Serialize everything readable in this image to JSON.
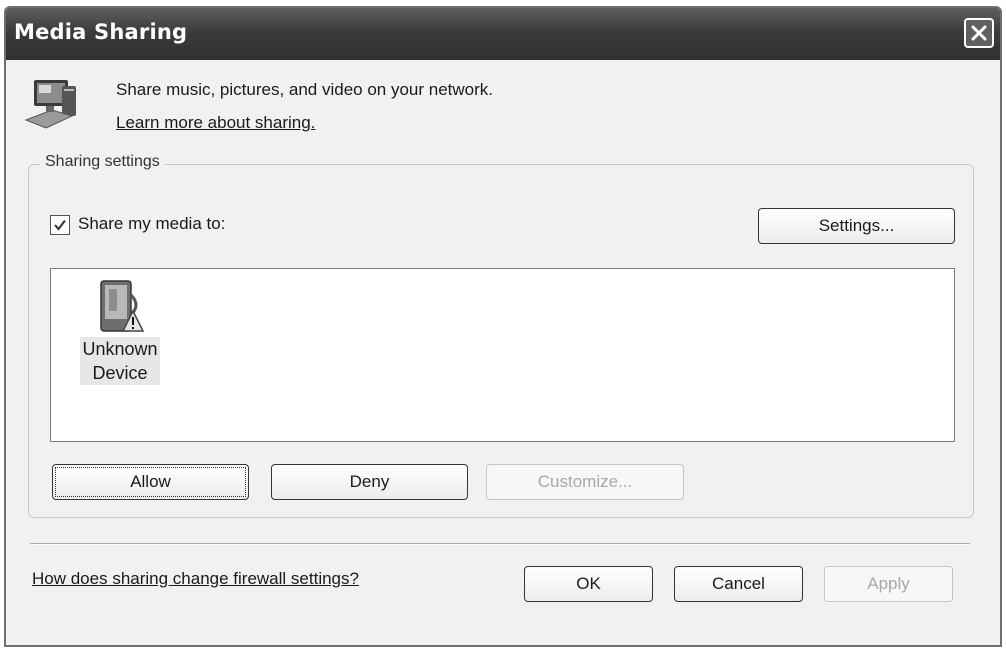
{
  "window": {
    "title": "Media Sharing"
  },
  "intro": {
    "text": "Share music, pictures, and video on your network.",
    "learn_more_link": "Learn more about sharing."
  },
  "sharing_settings": {
    "group_label": "Sharing settings",
    "share_checkbox_label": "Share my media to:",
    "share_checked": true,
    "settings_button": "Settings...",
    "devices": [
      {
        "name_line1": "Unknown",
        "name_line2": "Device",
        "icon": "unknown-device-icon"
      }
    ],
    "allow_button": "Allow",
    "deny_button": "Deny",
    "customize_button": "Customize...",
    "customize_enabled": false
  },
  "footer": {
    "help_link": "How does sharing change firewall settings?",
    "ok_button": "OK",
    "cancel_button": "Cancel",
    "apply_button": "Apply",
    "apply_enabled": false
  }
}
